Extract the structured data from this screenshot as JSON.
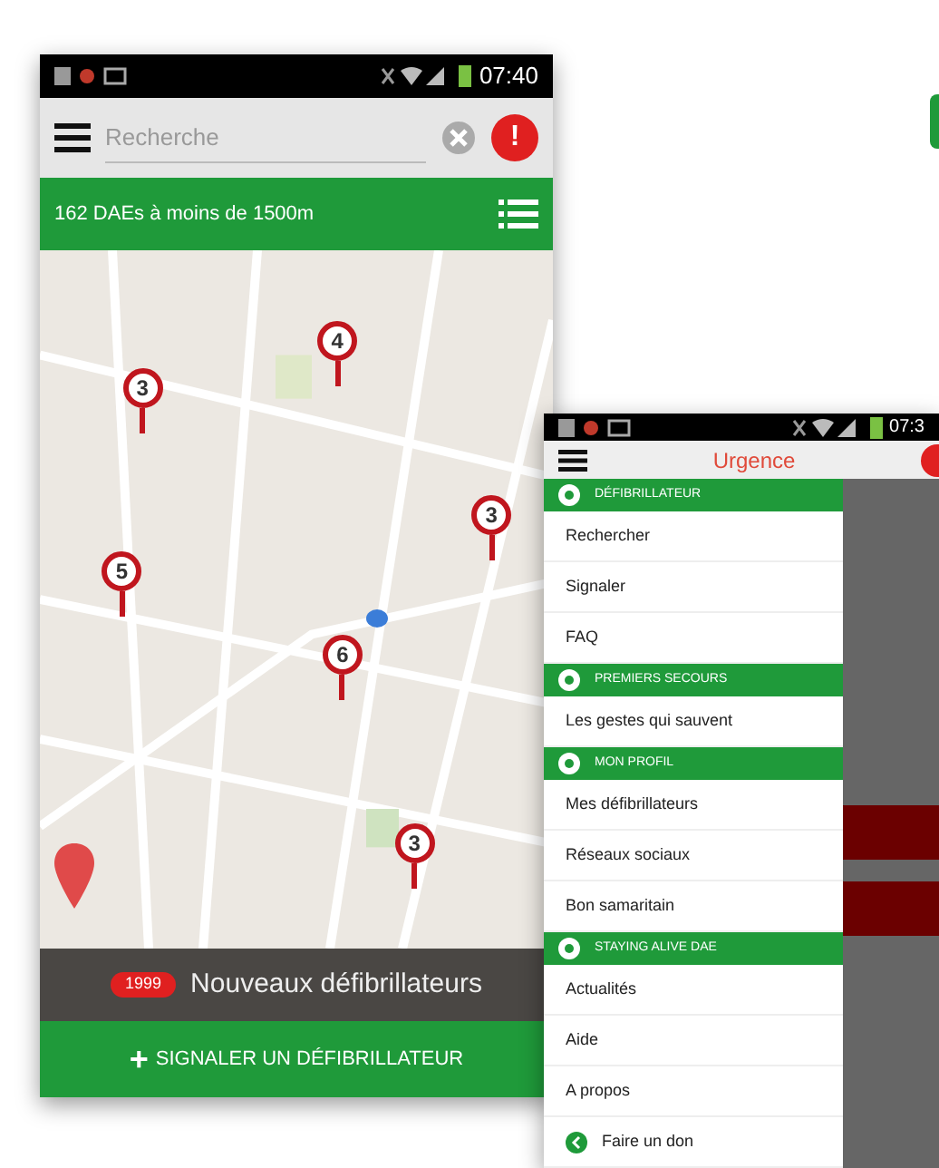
{
  "main_screen": {
    "status_bar": {
      "time": "07:40"
    },
    "search": {
      "placeholder": "Recherche"
    },
    "alert_button": "!",
    "results_bar": {
      "text": "162 DAEs à moins de 1500m"
    },
    "map": {
      "pins": [
        {
          "label": "4"
        },
        {
          "label": "3"
        },
        {
          "label": "3"
        },
        {
          "label": "5"
        },
        {
          "label": "6"
        },
        {
          "label": "3"
        }
      ]
    },
    "news_bar": {
      "badge": "1999",
      "text": "Nouveaux défibrillateurs"
    },
    "report_button": {
      "icon": "+",
      "label": "SIGNALER UN DÉFIBRILLATEUR"
    }
  },
  "menu_screen": {
    "status_bar": {
      "time": "07:3"
    },
    "title": "Urgence",
    "sections": [
      {
        "title": "DÉFIBRILLATEUR",
        "items": [
          {
            "label": "Rechercher",
            "kind": "plain"
          },
          {
            "label": "Signaler",
            "kind": "plain"
          },
          {
            "label": "FAQ",
            "kind": "plain"
          }
        ]
      },
      {
        "title": "PREMIERS SECOURS",
        "items": [
          {
            "label": "Les gestes qui sauvent",
            "kind": "plain"
          }
        ]
      },
      {
        "title": "MON PROFIL",
        "items": [
          {
            "label": "Mes défibrillateurs",
            "kind": "plain"
          },
          {
            "label": "Réseaux sociaux",
            "kind": "plain"
          },
          {
            "label": "Bon samaritain",
            "kind": "plain"
          }
        ]
      },
      {
        "title": "STAYING ALIVE DAE",
        "items": [
          {
            "label": "Actualités",
            "kind": "plain"
          },
          {
            "label": "Aide",
            "kind": "plain"
          },
          {
            "label": "A propos",
            "kind": "plain"
          },
          {
            "label": "Faire un don",
            "kind": "donate"
          }
        ]
      }
    ]
  }
}
